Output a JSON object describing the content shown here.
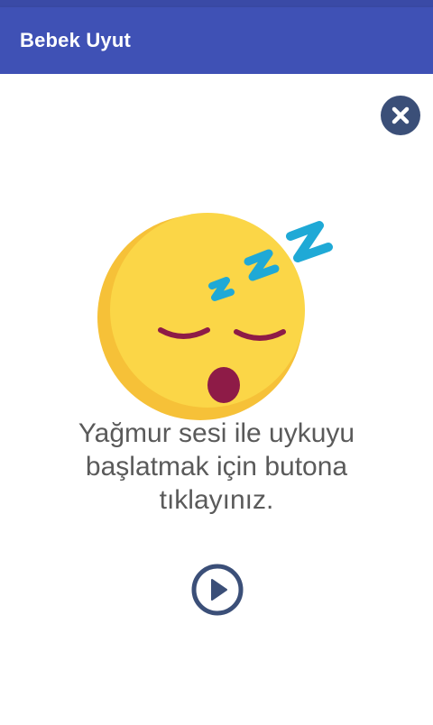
{
  "app_bar": {
    "title": "Bebek Uyut",
    "color": "#3f51b5"
  },
  "close_button": {
    "icon": "close-icon",
    "color": "#3b4f78"
  },
  "illustration": {
    "icon": "sleeping-face-icon",
    "face_color": "#fbd445",
    "zzz_color": "#1fa9d6",
    "mouth_color": "#8e1b47"
  },
  "message": {
    "line1": "Yağmur sesi ile uykuyu",
    "line2": "başlatmak için butona",
    "line3": "tıklayınız."
  },
  "play_button": {
    "icon": "play-icon",
    "color": "#3b4f78"
  }
}
